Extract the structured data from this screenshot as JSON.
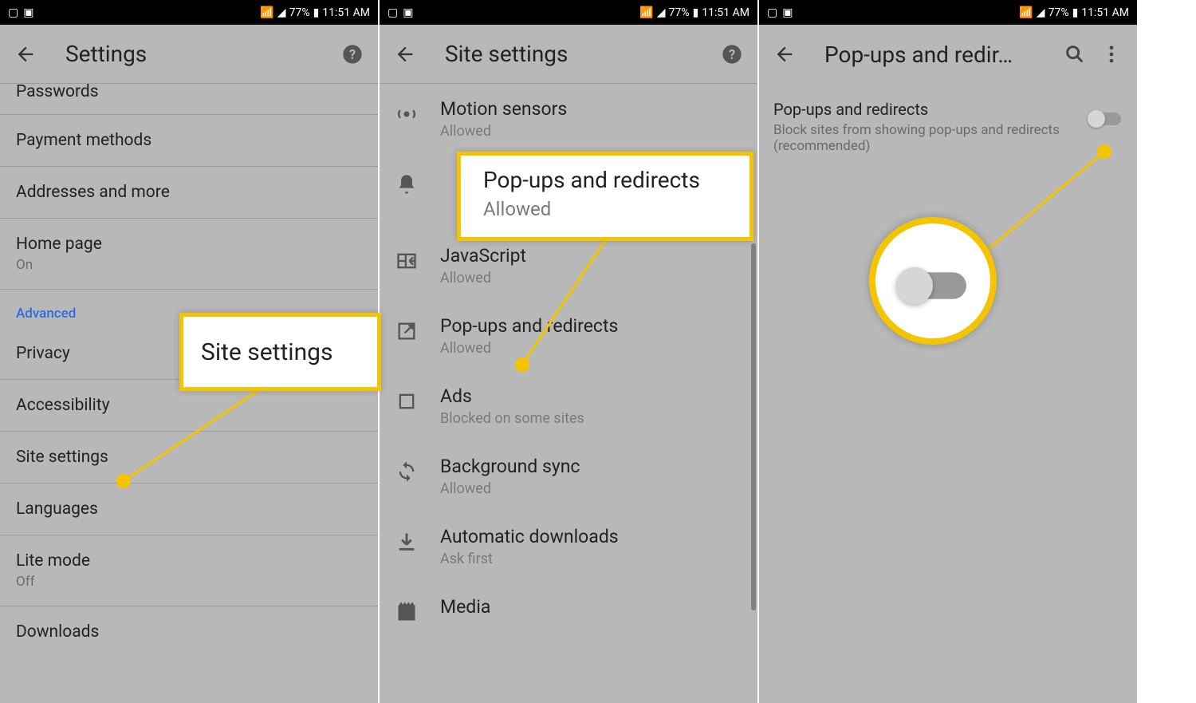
{
  "status": {
    "battery_pct": "77%",
    "time": "11:51 AM"
  },
  "phone1": {
    "title": "Settings",
    "items": [
      {
        "label": "Passwords"
      },
      {
        "label": "Payment methods"
      },
      {
        "label": "Addresses and more"
      },
      {
        "label": "Home page",
        "sub": "On"
      }
    ],
    "section": "Advanced",
    "adv_items": [
      {
        "label": "Privacy"
      },
      {
        "label": "Accessibility"
      },
      {
        "label": "Site settings"
      },
      {
        "label": "Languages"
      },
      {
        "label": "Lite mode",
        "sub": "Off"
      },
      {
        "label": "Downloads"
      }
    ]
  },
  "phone2": {
    "title": "Site settings",
    "items": [
      {
        "icon": "motion",
        "label": "Motion sensors",
        "sub": "Allowed"
      },
      {
        "icon": "bell",
        "label": "Notifications",
        "sub": ""
      },
      {
        "icon": "js",
        "label": "JavaScript",
        "sub": "Allowed"
      },
      {
        "icon": "popup",
        "label": "Pop-ups and redirects",
        "sub": "Allowed"
      },
      {
        "icon": "ads",
        "label": "Ads",
        "sub": "Blocked on some sites"
      },
      {
        "icon": "sync",
        "label": "Background sync",
        "sub": "Allowed"
      },
      {
        "icon": "download",
        "label": "Automatic downloads",
        "sub": "Ask first"
      },
      {
        "icon": "media",
        "label": "Media",
        "sub": ""
      }
    ]
  },
  "phone3": {
    "title": "Pop-ups and redir…",
    "row": {
      "label": "Pop-ups and redirects",
      "sub": "Block sites from showing pop-ups and redirects (recommended)"
    }
  },
  "callouts": {
    "site_settings": "Site settings",
    "popups_label": "Pop-ups and redirects",
    "popups_sub": "Allowed"
  }
}
